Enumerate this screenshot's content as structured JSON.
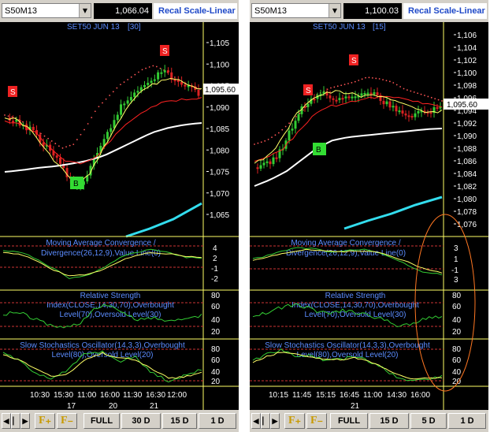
{
  "left": {
    "symbol": "S50M13",
    "price": "1,066.04",
    "scale_label": "Recal Scale-Linear",
    "chart_title": "SET50 JUN 13",
    "period": "[30]",
    "price_axis": [
      "1,105",
      "1,100",
      "1,095",
      "1,090",
      "1,085",
      "1,080",
      "1,075",
      "1,070",
      "1,065"
    ],
    "last_price": "1,095.60",
    "signals": [
      {
        "label": "S",
        "x": 0.048,
        "y": 1092.5
      },
      {
        "label": "S",
        "x": 0.75,
        "y": 1103.5
      },
      {
        "label": "B",
        "x": 0.375,
        "y": 1071.0
      }
    ],
    "macd": {
      "line1": "Moving Average Convergence /",
      "line2": "Divergence(26,12,9),Value Line(0)",
      "axis": [
        "4",
        "2",
        "-1",
        "-2"
      ]
    },
    "rs": {
      "line1": "Relative Strength",
      "line2": "Index(CLOSE,14,30,70),Overbought",
      "line3": "Level(70),Oversold Level(30)",
      "axis": [
        "80",
        "60",
        "40",
        "20"
      ]
    },
    "stoch": {
      "line1": "Slow Stochastics Oscillator(14,3,3),Overbought",
      "line2": "Level(80),Oversold Level(20)",
      "axis": [
        "80",
        "60",
        "40",
        "20"
      ]
    },
    "time_labels": [
      "10:30",
      "15:30",
      "11:00",
      "16:00",
      "11:30",
      "16:30",
      "12:00"
    ],
    "date_labels": [
      "17",
      "20",
      "21"
    ],
    "buttons": {
      "full": "FULL",
      "d30": "30 D",
      "d15": "15 D",
      "d1": "1 D"
    }
  },
  "right": {
    "symbol": "S50M13",
    "price": "1,100.03",
    "scale_label": "Recal Scale-Linear",
    "chart_title": "SET50 JUN 13",
    "period": "[15]",
    "price_axis": [
      "1,106",
      "1,104",
      "1,102",
      "1,100",
      "1,098",
      "1,096",
      "1,094",
      "1,092",
      "1,090",
      "1,088",
      "1,086",
      "1,084",
      "1,082",
      "1,080",
      "1,078",
      "1,076"
    ],
    "last_price": "1,095.60",
    "signals": [
      {
        "label": "S",
        "x": 0.3,
        "y": 1096.5
      },
      {
        "label": "S",
        "x": 0.51,
        "y": 1101.5
      },
      {
        "label": "B",
        "x": 0.36,
        "y": 1087.6
      }
    ],
    "macd": {
      "line1": "Moving Average Convergence /",
      "line2": "Divergence(26,12,9),Value Line(0)",
      "axis": [
        "3",
        "1",
        "-1",
        "3"
      ]
    },
    "rs": {
      "line1": "Relative Strength",
      "line2": "Index(CLOSE,14,30,70),Overbought",
      "line3": "Level(70),Oversold Level(30)",
      "axis": [
        "80",
        "60",
        "40",
        "20"
      ]
    },
    "stoch": {
      "line1": "Slow Stochastics Oscillator(14,3,3),Overbought",
      "line2": "Level(80),Oversold Level(20)",
      "axis": [
        "80",
        "60",
        "40",
        "20"
      ]
    },
    "time_labels": [
      "10:15",
      "11:45",
      "15:15",
      "16:45",
      "11:00",
      "14:30",
      "16:00"
    ],
    "date_labels": [
      "21"
    ],
    "buttons": {
      "full": "FULL",
      "d15": "15 D",
      "d5": "5 D",
      "d1": "1 D"
    }
  },
  "colors": {
    "bull": "#33cc33",
    "bear": "#dd2222",
    "ma_yellow": "#ffff66",
    "ma_red": "#ff2222",
    "ma_white": "#ffffff",
    "trend_cyan": "#33ddee",
    "divider": "#ffff66",
    "signal_s": "#ee2222",
    "signal_b": "#33dd33",
    "annotation": "#ff7722"
  }
}
